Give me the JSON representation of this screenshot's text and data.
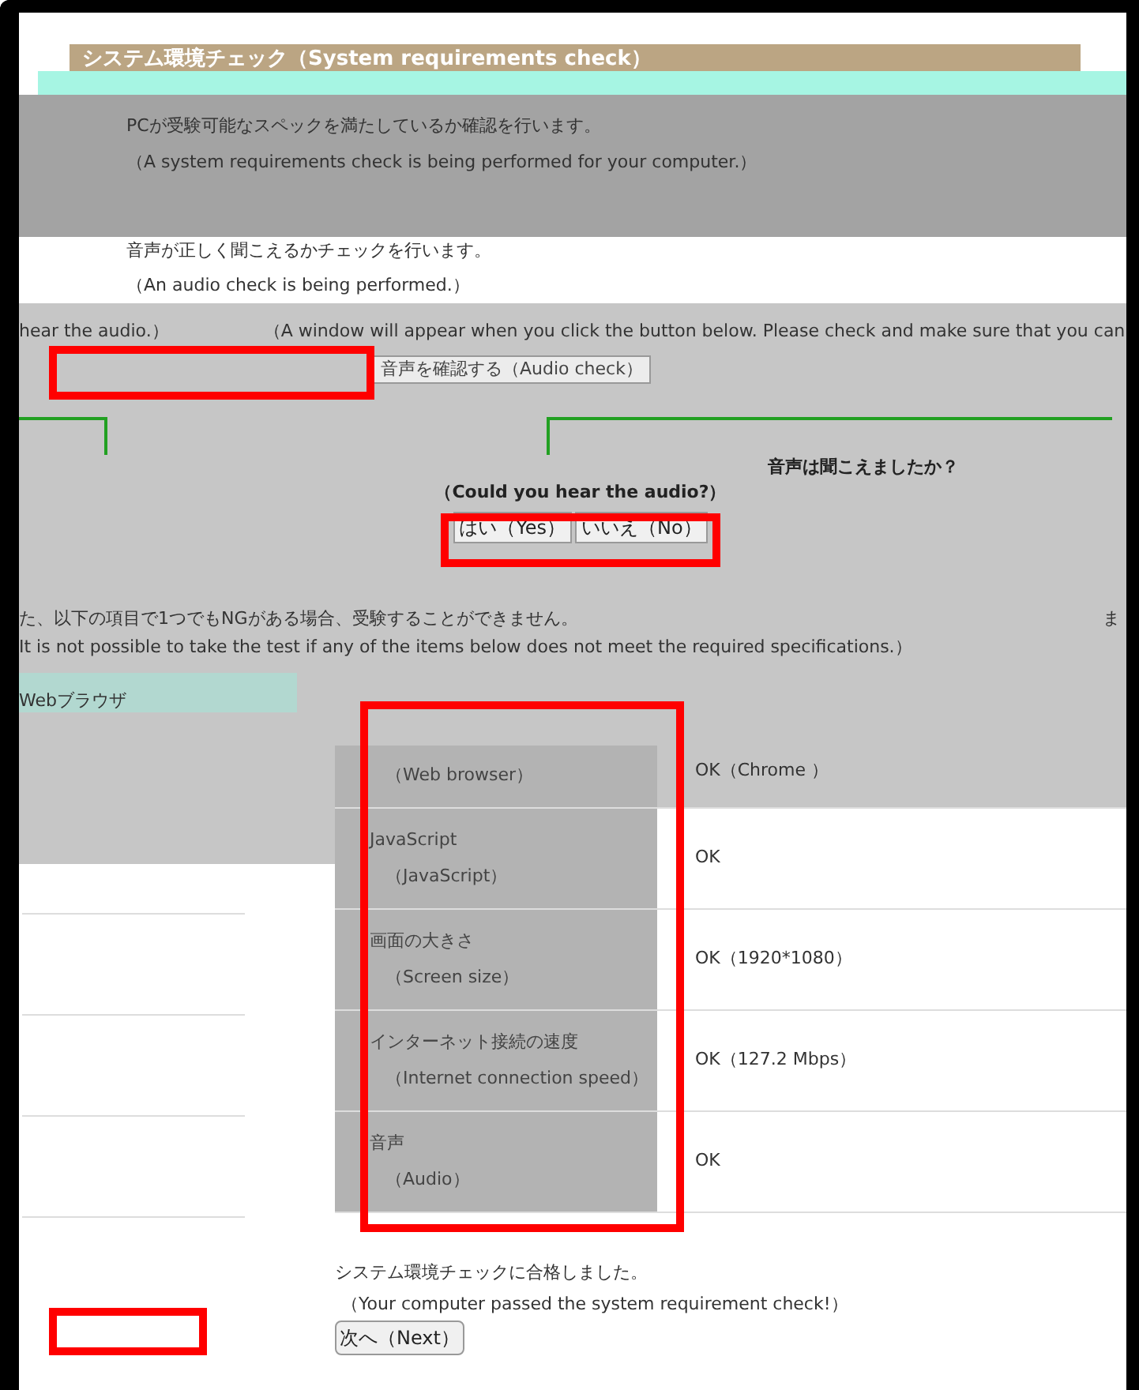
{
  "page_title": "システム環境チェック（System requirements check）",
  "intro": {
    "ja": "PCが受験可能なスペックを満たしているか確認を行います。",
    "en": "（A system requirements check is being performed for your computer.）"
  },
  "audio_check": {
    "ja": "音声が正しく聞こえるかチェックを行います。",
    "en": "（An audio check is being performed.）",
    "instruction_tail": "hear the audio.）",
    "instruction_en": "（A window will appear when you click the button below. Please check and make sure that you can",
    "button": "音声を確認する（Audio check）"
  },
  "audio_question": {
    "ja": "音声は聞こえましたか？",
    "en": "（Could you hear the audio?）",
    "buttons": [
      {
        "label": "はい（Yes）"
      },
      {
        "label": "いいえ（No）"
      }
    ]
  },
  "requirements": {
    "note_ja": "た、以下の項目で1つでもNGがある場合、受験することができません。",
    "note_fragment": "ま",
    "note_en": "It is not possible to take the test if any of the items below does not meet the required specifications.）",
    "rows": [
      {
        "label_ja": "Webブラウザ",
        "label_en": "（Web browser）",
        "result": "OK（Chrome ）"
      },
      {
        "label_ja": "JavaScript",
        "label_en": "（JavaScript）",
        "result": "OK"
      },
      {
        "label_ja": "画面の大きさ",
        "label_en": "（Screen size）",
        "result": "OK（1920*1080）"
      },
      {
        "label_ja": "インターネット接続の速度",
        "label_en": "（Internet connection speed）",
        "result": "OK（127.2 Mbps）"
      },
      {
        "label_ja": "音声",
        "label_en": "（Audio）",
        "result": "OK"
      }
    ]
  },
  "result": {
    "ja": "システム環境チェックに合格しました。",
    "en": "（Your computer passed the system requirement check!）"
  },
  "next_button": "次へ（Next）"
}
